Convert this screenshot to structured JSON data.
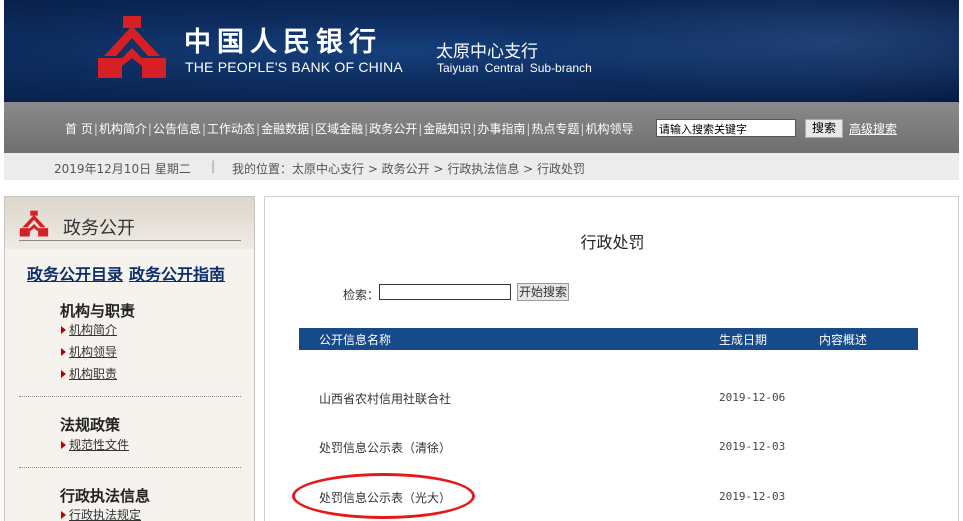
{
  "header": {
    "bank_cn": "中国人民银行",
    "bank_en": "THE PEOPLE'S BANK OF CHINA",
    "branch_cn": "太原中心支行",
    "branch_en": "Taiyuan Central Sub-branch",
    "logo_icon": "pboc-logo-icon",
    "colors": {
      "banner": "#0d2c5e",
      "logo_red": "#d71f26"
    }
  },
  "nav": {
    "items": [
      "首 页",
      "机构简介",
      "公告信息",
      "工作动态",
      "金融数据",
      "区域金融",
      "政务公开",
      "金融知识",
      "办事指南",
      "热点专题",
      "机构领导"
    ],
    "search_placeholder": "请输入搜索关键字",
    "search_button": "搜索",
    "advanced_search": "高级搜索"
  },
  "breadcrumb": {
    "date": "2019年12月10日 星期二",
    "separator": "|",
    "path": "我的位置：太原中心支行 > 政务公开 > 行政执法信息 > 行政处罚"
  },
  "sidebar": {
    "title": "政务公开",
    "top_links": [
      "政务公开目录",
      "政务公开指南"
    ],
    "sections": [
      {
        "title": "机构与职责",
        "items": [
          "机构简介",
          "机构领导",
          "机构职责"
        ]
      },
      {
        "title": "法规政策",
        "items": [
          "规范性文件"
        ]
      },
      {
        "title": "行政执法信息",
        "items": [
          "行政执法规定"
        ]
      }
    ]
  },
  "main": {
    "title": "行政处罚",
    "search_label": "检索：",
    "search_button": "开始搜索",
    "table": {
      "headers": [
        "公开信息名称",
        "生成日期",
        "内容概述"
      ],
      "rows": [
        {
          "name": "山西省农村信用社联合社",
          "date": "2019-12-06"
        },
        {
          "name": "处罚信息公示表（清徐）",
          "date": "2019-12-03"
        },
        {
          "name": "处罚信息公示表（光大）",
          "date": "2019-12-03"
        }
      ]
    },
    "highlight_color": "#e41a1a"
  }
}
